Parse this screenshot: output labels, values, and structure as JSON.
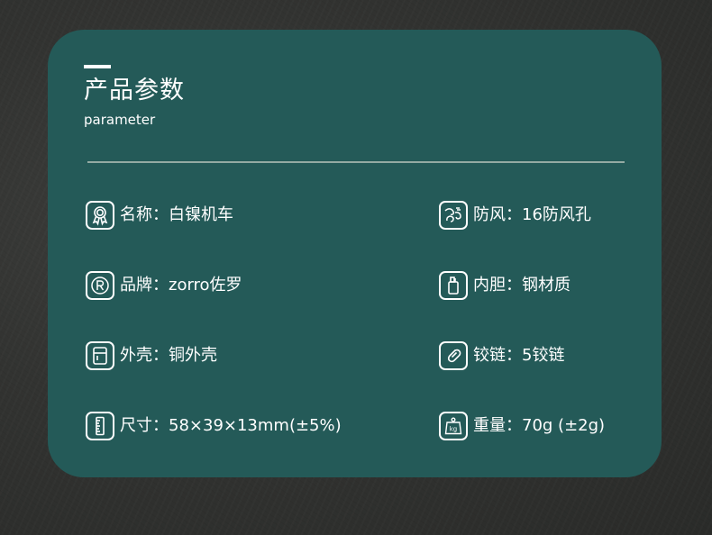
{
  "header": {
    "title": "产品参数",
    "subtitle": "parameter"
  },
  "specs": {
    "name": {
      "icon": "award-ribbon-icon",
      "text": "名称：白镍机车"
    },
    "brand": {
      "icon": "registered-trademark-icon",
      "text": "品牌：zorro佐罗"
    },
    "shell": {
      "icon": "lighter-shell-icon",
      "text": "外壳：铜外壳"
    },
    "size": {
      "icon": "ruler-icon",
      "text": "尺寸：58×39×13mm(±5%)"
    },
    "windproof": {
      "icon": "wind-icon",
      "text": "防风：16防风孔"
    },
    "liner": {
      "icon": "lighter-liner-icon",
      "text": "内胆：钢材质"
    },
    "hinge": {
      "icon": "hinge-link-icon",
      "text": "铰链：5铰链"
    },
    "weight": {
      "icon": "weight-kg-icon",
      "text": "重量：70g (±2g)"
    }
  },
  "colors": {
    "card": "#245a58",
    "background": "#323331",
    "text": "#ffffff",
    "divider": "#a8b8b0"
  }
}
